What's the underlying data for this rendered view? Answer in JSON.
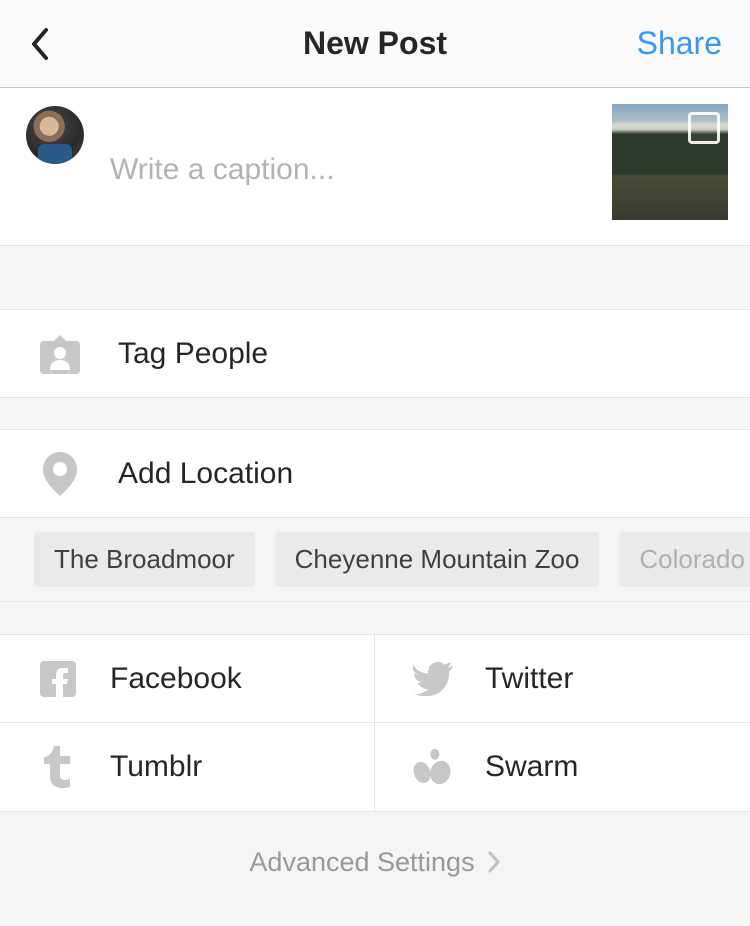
{
  "header": {
    "title": "New Post",
    "share_label": "Share"
  },
  "caption": {
    "placeholder": "Write a caption..."
  },
  "rows": {
    "tag_people": "Tag People",
    "add_location": "Add Location"
  },
  "location_chips": [
    "The Broadmoor",
    "Cheyenne Mountain Zoo",
    "Colorado"
  ],
  "share_targets": {
    "facebook": "Facebook",
    "twitter": "Twitter",
    "tumblr": "Tumblr",
    "swarm": "Swarm"
  },
  "advanced_label": "Advanced Settings"
}
